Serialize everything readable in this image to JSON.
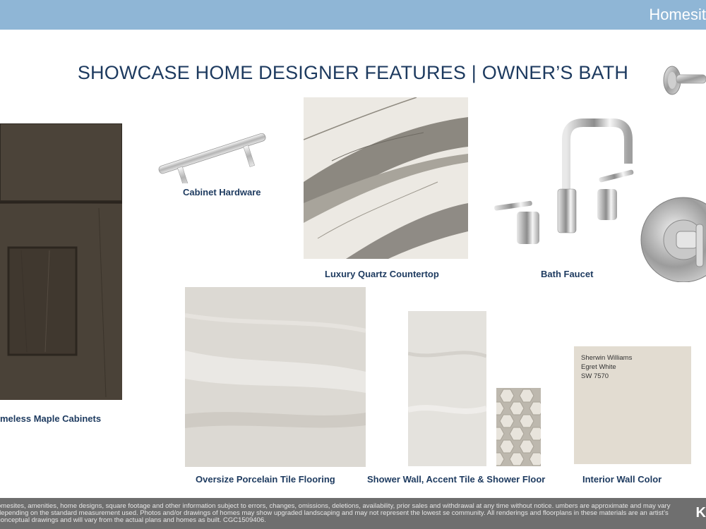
{
  "header": {
    "brand": "Homesit"
  },
  "title": "SHOWCASE HOME DESIGNER FEATURES | OWNER’S BATH",
  "features": {
    "cabinets": "meless Maple Cabinets",
    "hardware": "Cabinet Hardware",
    "countertop": "Luxury Quartz Countertop",
    "faucet": "Bath Faucet",
    "flooring": "Oversize Porcelain Tile Flooring",
    "shower": "Shower Wall, Accent Tile & Shower Floor",
    "wall_color": "Interior Wall Color"
  },
  "paint": {
    "brand": "Sherwin Williams",
    "name": "Egret White",
    "code": "SW 7570"
  },
  "footer": {
    "disclaimer": "omesites, amenities, home designs, square footage and other information subject to errors, changes, omissions, deletions, availability, prior sales and withdrawal at any time without notice. umbers are approximate and may vary depending on the standard measurement used. Photos and/or drawings of homes may show upgraded landscaping and may not represent the lowest se community. All renderings and floorplans in these materials are an artist’s conceptual drawings and will vary from the actual plans and homes as built. CGC1509406.",
    "mark": "K"
  },
  "colors": {
    "header_bar": "#8fb6d6",
    "title_text": "#1d3a5f",
    "cabinet": "#4a4238",
    "paint_swatch": "#e2dcd1",
    "footer_bar": "#6f6f6f"
  }
}
